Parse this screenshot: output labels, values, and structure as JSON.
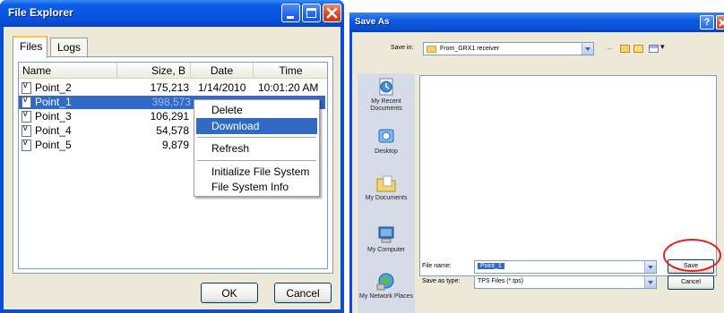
{
  "file_explorer": {
    "title": "File Explorer",
    "tabs": [
      {
        "label": "Files"
      },
      {
        "label": "Logs"
      }
    ],
    "columns": [
      "Name",
      "Size, B",
      "Date",
      "Time"
    ],
    "rows": [
      {
        "name": "Point_2",
        "size": "175,213",
        "date": "1/14/2010",
        "time": "10:01:20 AM"
      },
      {
        "name": "Point_1",
        "size": "398,573",
        "date": "",
        "time": ""
      },
      {
        "name": "Point_3",
        "size": "106,291",
        "date": "",
        "time": ""
      },
      {
        "name": "Point_4",
        "size": "54,578",
        "date": "",
        "time": ""
      },
      {
        "name": "Point_5",
        "size": "9,879",
        "date": "",
        "time": ""
      }
    ],
    "selected_row_index": 1,
    "context_menu": {
      "items": [
        "Delete",
        "Download",
        "Refresh",
        "Initialize File System",
        "File System Info"
      ],
      "highlighted": "Download"
    },
    "ok_label": "OK",
    "cancel_label": "Cancel"
  },
  "save_as": {
    "title": "Save As",
    "save_in_label": "Save in:",
    "save_in_value": "From_GRX1 receiver",
    "places": [
      {
        "label": "My Recent Documents",
        "icon": "recent-documents-icon"
      },
      {
        "label": "Desktop",
        "icon": "desktop-icon"
      },
      {
        "label": "My Documents",
        "icon": "my-documents-icon"
      },
      {
        "label": "My Computer",
        "icon": "my-computer-icon"
      },
      {
        "label": "My Network Places",
        "icon": "network-places-icon"
      }
    ],
    "file_name_label": "File name:",
    "file_name_value": "Point_1",
    "save_as_type_label": "Save as type:",
    "save_as_type_value": "TPS Files (*.tps)",
    "save_label": "Save",
    "cancel_label": "Cancel",
    "highlight_color": "#e02020"
  },
  "colors": {
    "titlebar": "#0a4dd6",
    "selection": "#316ac5",
    "window_face": "#ece9d8"
  }
}
